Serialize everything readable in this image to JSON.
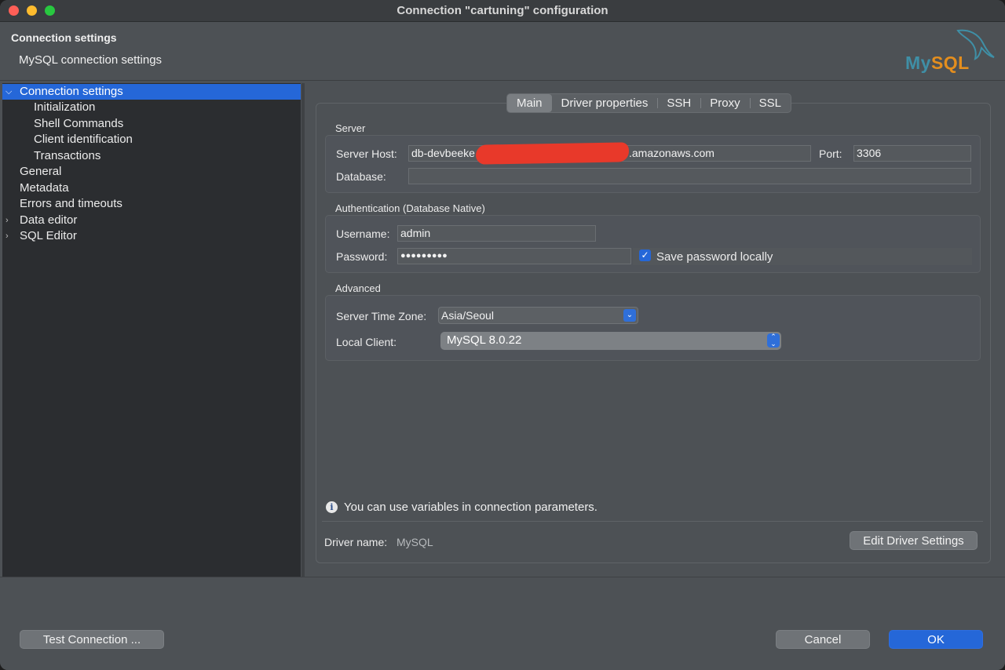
{
  "window": {
    "title": "Connection \"cartuning\" configuration"
  },
  "header": {
    "title": "Connection settings",
    "subtitle": "MySQL connection settings",
    "logo_my": "My",
    "logo_sql": "SQL"
  },
  "sidebar": {
    "items": [
      {
        "label": "Connection settings",
        "expanded": true,
        "selected": true
      },
      {
        "label": "Initialization"
      },
      {
        "label": "Shell Commands"
      },
      {
        "label": "Client identification"
      },
      {
        "label": "Transactions"
      },
      {
        "label": "General"
      },
      {
        "label": "Metadata"
      },
      {
        "label": "Errors and timeouts"
      },
      {
        "label": "Data editor",
        "expandable": true
      },
      {
        "label": "SQL Editor",
        "expandable": true
      }
    ]
  },
  "tabs": [
    {
      "label": "Main",
      "active": true
    },
    {
      "label": "Driver properties"
    },
    {
      "label": "SSH"
    },
    {
      "label": "Proxy"
    },
    {
      "label": "SSL"
    }
  ],
  "server": {
    "group_label": "Server",
    "host_label": "Server Host:",
    "host_prefix": "db-devbeeke",
    "host_suffix": ".amazonaws.com",
    "port_label": "Port:",
    "port_value": "3306",
    "database_label": "Database:",
    "database_value": ""
  },
  "auth": {
    "group_label": "Authentication (Database Native)",
    "username_label": "Username:",
    "username_value": "admin",
    "password_label": "Password:",
    "password_value": "●●●●●●●●●",
    "save_password_label": "Save password locally",
    "save_password_checked": true
  },
  "advanced": {
    "group_label": "Advanced",
    "timezone_label": "Server Time Zone:",
    "timezone_value": "Asia/Seoul",
    "local_client_label": "Local Client:",
    "local_client_value": "MySQL 8.0.22"
  },
  "info": {
    "text": "You can use variables in connection parameters."
  },
  "driver": {
    "label": "Driver name:",
    "value": "MySQL",
    "edit_button": "Edit Driver Settings"
  },
  "footer": {
    "test_button": "Test Connection ...",
    "cancel_button": "Cancel",
    "ok_button": "OK"
  },
  "colors": {
    "accent": "#2567d8",
    "redaction": "#e8392a"
  }
}
